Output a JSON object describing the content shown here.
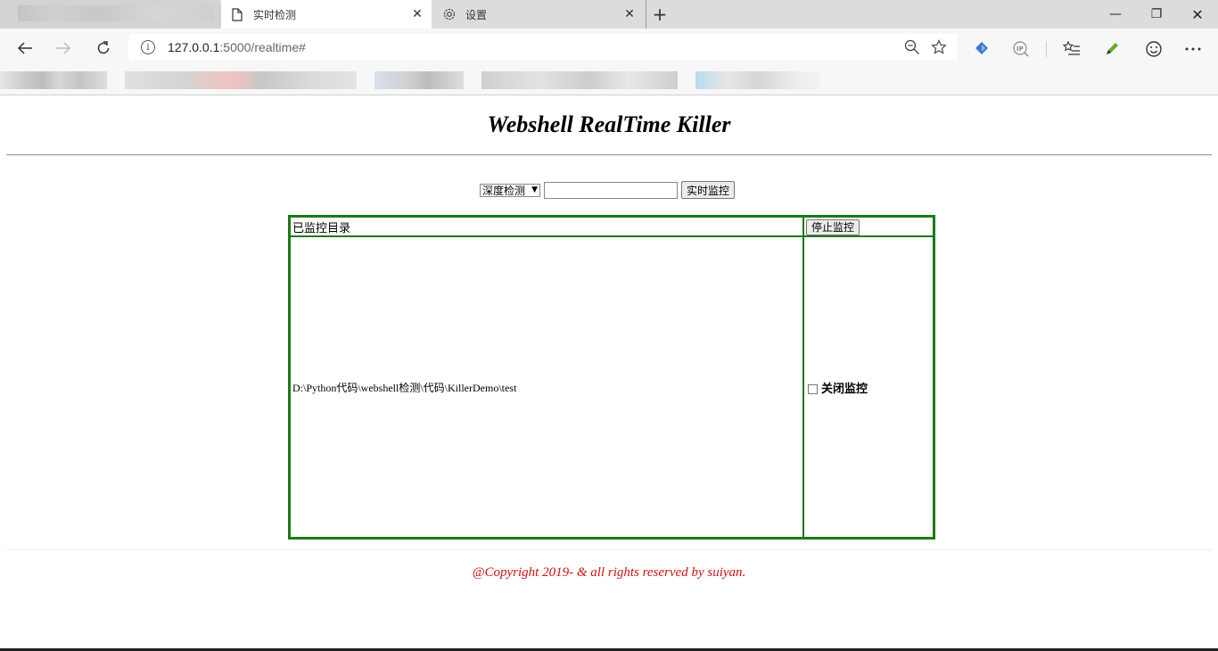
{
  "browser": {
    "tabs": [
      {
        "label": "实时检测",
        "icon": "page-icon",
        "active": true
      },
      {
        "label": "设置",
        "icon": "gear-icon",
        "active": false
      }
    ],
    "close_glyph": "✕",
    "newtab_glyph": "+",
    "window": {
      "minimize": "—",
      "restore": "❐",
      "close": "✕"
    },
    "url_host": "127.0.0.1",
    "url_rest": ":5000/realtime#"
  },
  "page": {
    "title": "Webshell RealTime Killer",
    "mode_select": {
      "selected": "深度检测",
      "arrow": "▼"
    },
    "path_input": {
      "value": ""
    },
    "start_button": "实时监控",
    "table": {
      "header_label": "已监控目录",
      "stop_button": "停止监控",
      "rows": [
        {
          "path": "D:\\Python代码\\webshell检测\\代码\\KillerDemo\\test",
          "checkbox_label": "关闭监控"
        }
      ]
    },
    "footer": "@Copyright 2019- & all rights reserved by suiyan."
  }
}
